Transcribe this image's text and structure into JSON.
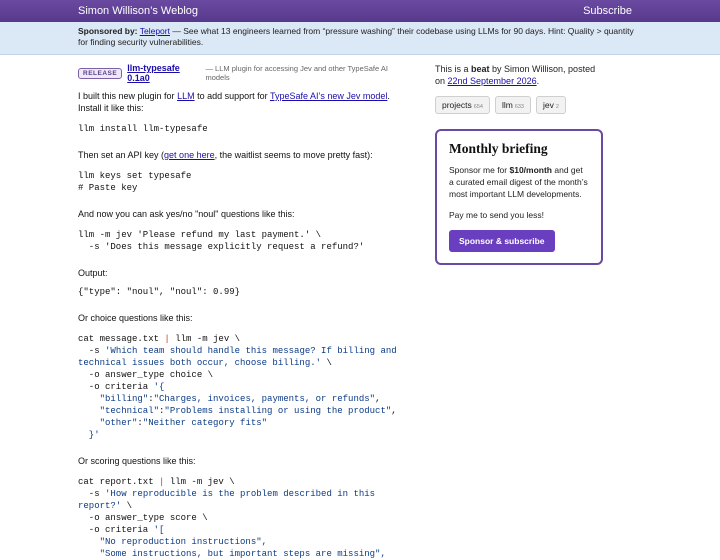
{
  "header": {
    "site_title": "Simon Willison’s Weblog",
    "subscribe_label": "Subscribe"
  },
  "sponsor": {
    "prefix": "Sponsored by:",
    "link": "Teleport",
    "text": " — See what 13 engineers learned from “pressure washing” their codebase using LLMs for 90 days. Hint: Quality > quantity for finding security vulnerabilities."
  },
  "entry": {
    "badge": "RELEASE",
    "title": "llm-typesafe 0.1a0",
    "subtitle": "— LLM plugin for accessing Jev and other TypeSafe AI models",
    "intro_1": "I built this new plugin for ",
    "intro_link_1": "LLM",
    "intro_2": " to add support for ",
    "intro_link_2": "TypeSafe AI’s new Jev model",
    "intro_3": ". Install it like this:",
    "install_cmd": "llm install llm-typesafe",
    "apikey_1": "Then set an API key (",
    "apikey_link": "get one here",
    "apikey_2": ", the waitlist seems to move pretty fast):",
    "keys_line1": "llm keys set typesafe",
    "keys_line2": "# Paste key",
    "yesno_text": "And now you can ask yes/no \"noul\" questions like this:",
    "yesno_line1": "llm -m jev 'Please refund my last payment.' \\",
    "yesno_line2": "  -s 'Does this message explicitly request a refund?'",
    "output_label": "Output:",
    "output_json": "{\"type\": \"noul\", \"noul\": 0.99}",
    "choice_text": "Or choice questions like this:",
    "choice": {
      "l1a": "cat message.txt ",
      "pipe": "|",
      "l1b": " llm -m jev \\",
      "l2a": "  -s ",
      "l2b": "'Which team should handle this message? If billing and",
      "l3": "technical issues both occur, choose billing.'",
      "l3b": " \\",
      "l4": "  -o answer_type choice \\",
      "l5a": "  -o criteria ",
      "l5b": "'{",
      "l6a": "    \"billing\"",
      "l6b": ":",
      "l6c": "\"Charges, invoices, payments, or refunds\"",
      "l6d": ",",
      "l7a": "    \"technical\"",
      "l7b": ":",
      "l7c": "\"Problems installing or using the product\"",
      "l7d": ",",
      "l8a": "    \"other\"",
      "l8b": ":",
      "l8c": "\"Neither category fits\"",
      "l9": "  }'"
    },
    "scoring_text": "Or scoring questions like this:",
    "scoring": {
      "l1a": "cat report.txt ",
      "pipe": "|",
      "l1b": " llm -m jev \\",
      "l2a": "  -s ",
      "l2b": "'How reproducible is the problem described in this",
      "l3": "report?'",
      "l3b": " \\",
      "l4": "  -o answer_type score \\",
      "l5a": "  -o criteria ",
      "l5b": "'[",
      "l6": "    \"No reproduction instructions\",",
      "l7": "    \"Some instructions, but important steps are missing\","
    }
  },
  "sidebar": {
    "beat_1": "This is a ",
    "beat_bold": "beat",
    "beat_2": " by Simon Willison, posted on ",
    "beat_date": "22nd September 2026",
    "beat_3": ".",
    "tags": [
      {
        "name": "projects",
        "count": "654"
      },
      {
        "name": "llm",
        "count": "633"
      },
      {
        "name": "jev",
        "count": "2"
      }
    ],
    "brief_title": "Monthly briefing",
    "brief_1": "Sponsor me for ",
    "brief_bold": "$10/month",
    "brief_2": " and get a curated email digest of the month’s most important LLM developments.",
    "brief_pay": "Pay me to send you less!",
    "brief_button": "Sponsor & subscribe"
  },
  "colors": {
    "header_bg": "#5e3f95",
    "sponsor_bg": "#dbe8f5",
    "accent": "#6a3fbf",
    "link": "#1a0dab"
  }
}
